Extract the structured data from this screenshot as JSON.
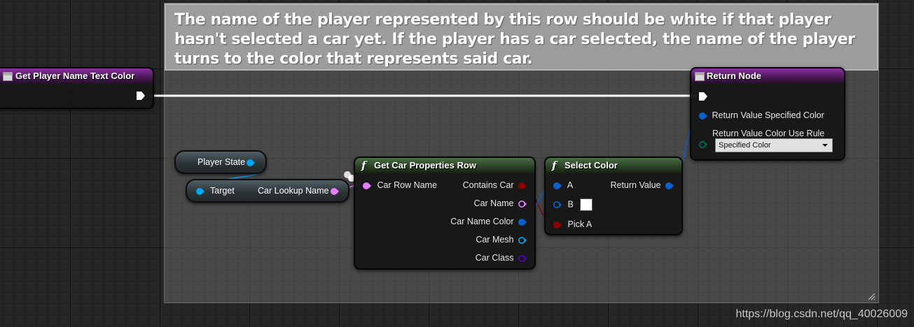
{
  "comment": {
    "text": "The name of the player represented by this row should be white if that player hasn't selected a car yet. If the player has a car selected, the name of the player turns to the color that represents said car."
  },
  "entry_node": {
    "title": "Get Player Name Text Color"
  },
  "return_node": {
    "title": "Return Node",
    "pins": {
      "specified_color": "Return Value Specified Color",
      "color_use_rule": "Return Value Color Use Rule"
    },
    "dropdown_value": "Specified Color"
  },
  "player_state_node": {
    "label": "Player State"
  },
  "break_struct_node": {
    "target_label": "Target",
    "output_label": "Car Lookup Name"
  },
  "get_car_props_node": {
    "title": "Get Car Properties Row",
    "input_pins": [
      "Car Row Name"
    ],
    "output_pins": [
      "Contains Car",
      "Car Name",
      "Car Name Color",
      "Car Mesh",
      "Car Class"
    ]
  },
  "select_color_node": {
    "title": "Select Color",
    "input_pins": [
      "A",
      "B",
      "Pick A"
    ],
    "output_pin": "Return Value"
  },
  "watermark": "https://blog.csdn.net/qq_40026009",
  "colors": {
    "exec_wire": "#ffffff",
    "struct_pin": "#0a62ce",
    "string_pin": "#e77dff",
    "bool_pin": "#8b0000",
    "object_pin": "#00a8f2",
    "class_pin": "#5a00c6",
    "enum_pin": "#007161",
    "function_header": "#3f5c39",
    "event_header": "#6c2a7e"
  }
}
